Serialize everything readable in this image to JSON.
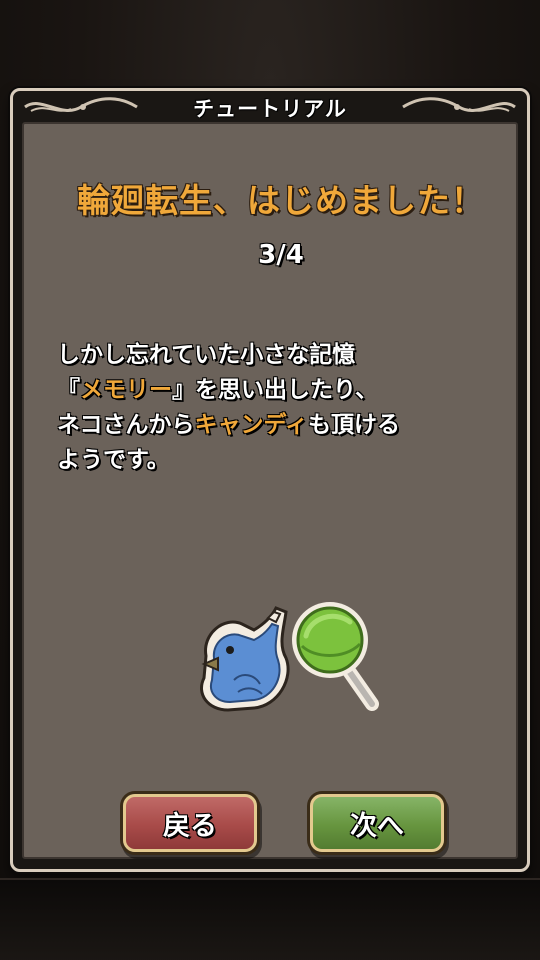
{
  "dialog": {
    "header_title": "チュートリアル",
    "headline": "輪廻転生、はじめました！",
    "page_counter": "3/4",
    "body": {
      "line1": "しかし忘れていた小さな記憶",
      "line2_prefix": "『",
      "line2_highlight": "メモリー",
      "line2_suffix": "』を思い出したり、",
      "line3_prefix": "ネコさんから",
      "line3_highlight": "キャンディ",
      "line3_suffix": "も頂ける",
      "line4": "ようです。"
    },
    "illustration": {
      "items": [
        "memory-bird-whistle-icon",
        "candy-lollipop-icon"
      ]
    },
    "buttons": {
      "back_label": "戻る",
      "next_label": "次へ"
    }
  },
  "colors": {
    "highlight": "#f0a83a",
    "panel": "#6b625a",
    "back_button": "#a84b49",
    "next_button": "#67953f"
  }
}
